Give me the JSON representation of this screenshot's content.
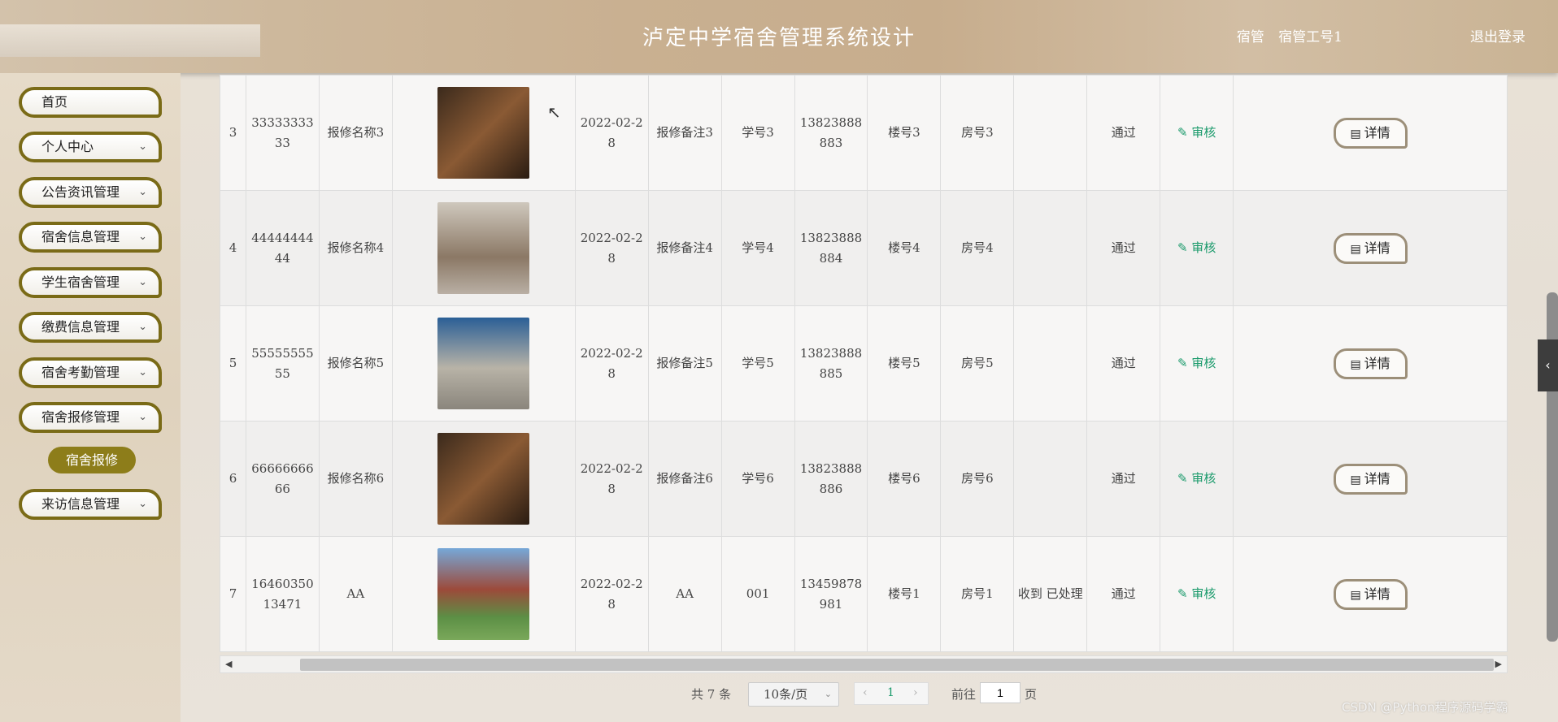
{
  "header": {
    "title": "泸定中学宿舍管理系统设计",
    "role": "宿管",
    "account": "宿管工号1",
    "logout": "退出登录"
  },
  "sidebar": {
    "items": [
      {
        "label": "首页",
        "has_arrow": false
      },
      {
        "label": "个人中心",
        "has_arrow": true
      },
      {
        "label": "公告资讯管理",
        "has_arrow": true
      },
      {
        "label": "宿舍信息管理",
        "has_arrow": true
      },
      {
        "label": "学生宿舍管理",
        "has_arrow": true
      },
      {
        "label": "缴费信息管理",
        "has_arrow": true
      },
      {
        "label": "宿舍考勤管理",
        "has_arrow": true
      },
      {
        "label": "宿舍报修管理",
        "has_arrow": true
      },
      {
        "label": "来访信息管理",
        "has_arrow": true
      }
    ],
    "sub_item": "宿舍报修"
  },
  "table": {
    "audit_label": "审核",
    "detail_label": "详情",
    "rows": [
      {
        "index": "3",
        "code": "3333333333",
        "name": "报修名称3",
        "date": "2022-02-28",
        "remark": "报修备注3",
        "student": "学号3",
        "phone": "13823888883",
        "building": "楼号3",
        "room": "房号3",
        "reply": "",
        "status": "通过",
        "img": "room-a"
      },
      {
        "index": "4",
        "code": "4444444444",
        "name": "报修名称4",
        "date": "2022-02-28",
        "remark": "报修备注4",
        "student": "学号4",
        "phone": "13823888884",
        "building": "楼号4",
        "room": "房号4",
        "reply": "",
        "status": "通过",
        "img": "room-b"
      },
      {
        "index": "5",
        "code": "5555555555",
        "name": "报修名称5",
        "date": "2022-02-28",
        "remark": "报修备注5",
        "student": "学号5",
        "phone": "13823888885",
        "building": "楼号5",
        "room": "房号5",
        "reply": "",
        "status": "通过",
        "img": "room-c"
      },
      {
        "index": "6",
        "code": "6666666666",
        "name": "报修名称6",
        "date": "2022-02-28",
        "remark": "报修备注6",
        "student": "学号6",
        "phone": "13823888886",
        "building": "楼号6",
        "room": "房号6",
        "reply": "",
        "status": "通过",
        "img": "room-a"
      },
      {
        "index": "7",
        "code": "1646035013471",
        "name": "AA",
        "date": "2022-02-28",
        "remark": "AA",
        "student": "001",
        "phone": "13459878981",
        "building": "楼号1",
        "room": "房号1",
        "reply": "收到 已处理",
        "status": "通过",
        "img": "building"
      }
    ]
  },
  "pagination": {
    "total_prefix": "共",
    "total": "7",
    "total_suffix": "条",
    "page_size": "10条/页",
    "current_page": "1",
    "goto_label": "前往",
    "goto_value": "1",
    "page_suffix": "页"
  },
  "watermark": "CSDN @Python程序源码学霸",
  "colors": {
    "audit": "#1a9a6b",
    "menu_border": "#7a6b17",
    "sub_item_bg": "#8d7d1a"
  }
}
